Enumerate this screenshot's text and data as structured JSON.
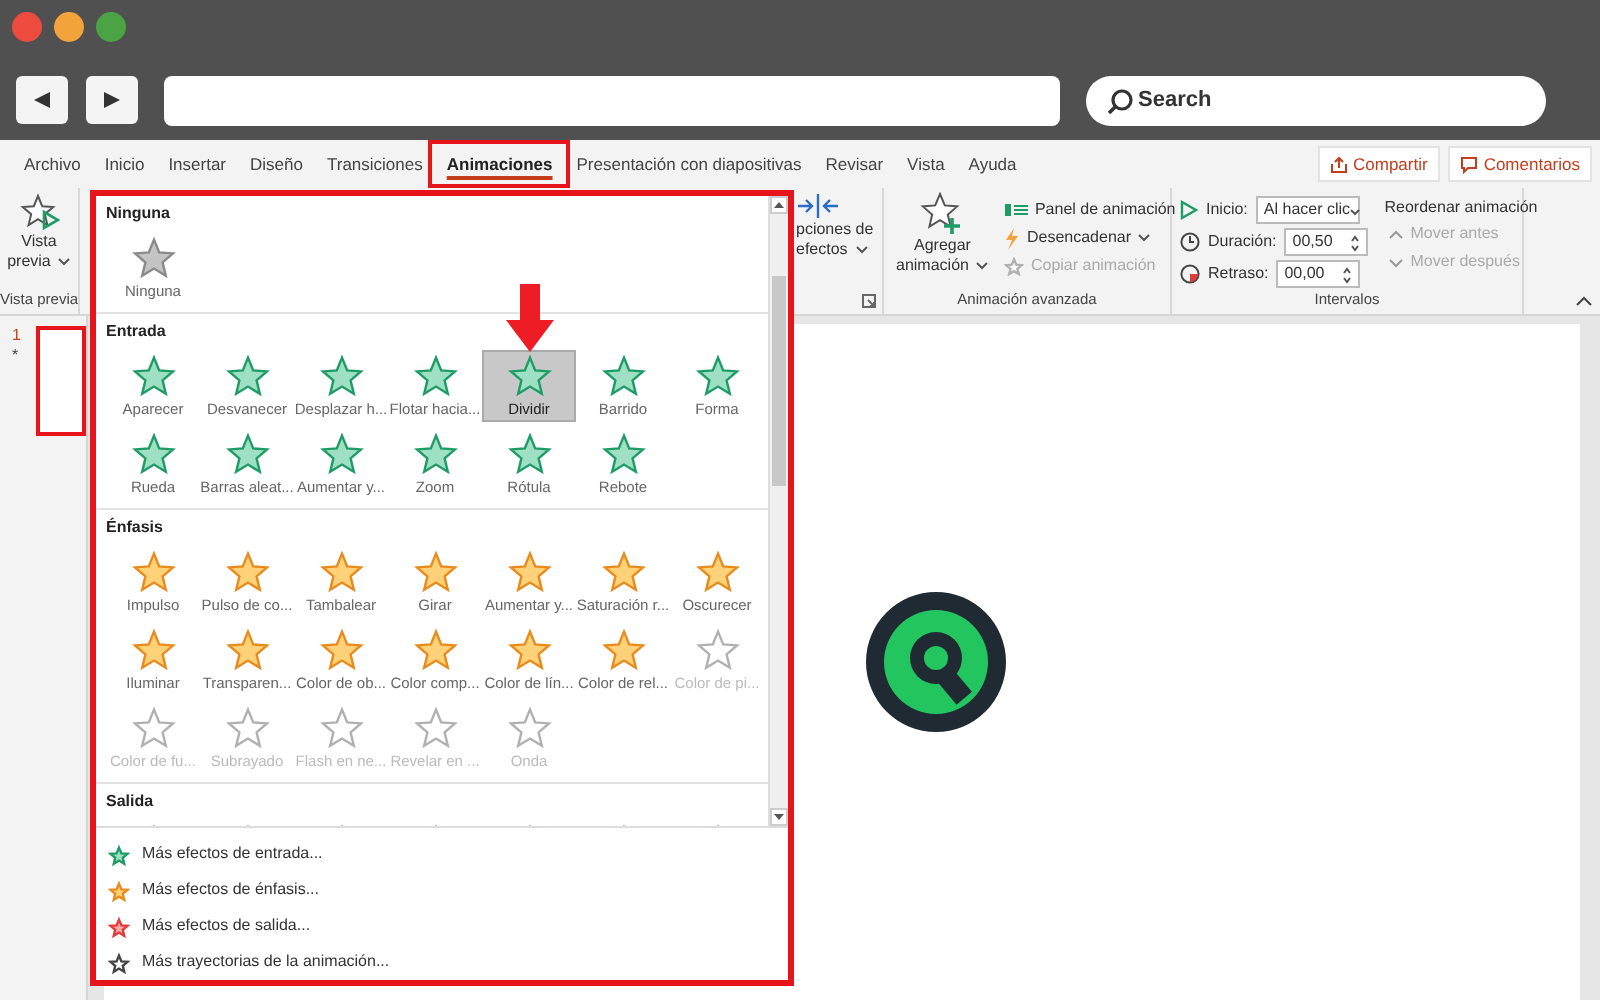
{
  "browser": {
    "search": {
      "placeholder": "Search"
    }
  },
  "ribbon": {
    "tabs": [
      {
        "label": "Archivo",
        "selected": false
      },
      {
        "label": "Inicio",
        "selected": false
      },
      {
        "label": "Insertar",
        "selected": false
      },
      {
        "label": "Diseño",
        "selected": false
      },
      {
        "label": "Transiciones",
        "selected": false
      },
      {
        "label": "Animaciones",
        "selected": true
      },
      {
        "label": "Presentación con diapositivas",
        "selected": false
      },
      {
        "label": "Revisar",
        "selected": false
      },
      {
        "label": "Vista",
        "selected": false
      },
      {
        "label": "Ayuda",
        "selected": false
      }
    ],
    "share_button": "Compartir",
    "comments_button": "Comentarios",
    "preview": {
      "label_line_1": "Vista",
      "label_line_2": "previa",
      "group": "Vista previa"
    },
    "effect_options": {
      "label_line_1": "pciones de",
      "label_line_2": "efectos"
    },
    "advanced": {
      "add_line_1": "Agregar",
      "add_line_2": "animación",
      "panel": "Panel de animación",
      "trigger": "Desencadenar",
      "copy": {
        "label": "Copiar animación",
        "disabled": true
      },
      "group": "Animación avanzada"
    },
    "timing": {
      "start_label": "Inicio:",
      "start_value": "Al hacer clic",
      "duration_label": "Duración:",
      "duration_value": "00,50",
      "delay_label": "Retraso:",
      "delay_value": "00,00",
      "reorder": "Reordenar animación",
      "move_earlier": {
        "label": "Mover antes",
        "disabled": true
      },
      "move_later": {
        "label": "Mover después",
        "disabled": true
      },
      "group": "Intervalos"
    }
  },
  "slides": [
    {
      "number": "1",
      "mark": "*",
      "selected": true
    }
  ],
  "gallery": {
    "sections": [
      {
        "title": "Ninguna",
        "kind": "none",
        "items": [
          {
            "label": "Ninguna",
            "selected": false,
            "disabled": false
          }
        ]
      },
      {
        "title": "Entrada",
        "kind": "entrance",
        "items": [
          {
            "label": "Aparecer",
            "selected": false,
            "disabled": false
          },
          {
            "label": "Desvanecer",
            "selected": false,
            "disabled": false
          },
          {
            "label": "Desplazar h...",
            "selected": false,
            "disabled": false
          },
          {
            "label": "Flotar hacia...",
            "selected": false,
            "disabled": false
          },
          {
            "label": "Dividir",
            "selected": true,
            "disabled": false
          },
          {
            "label": "Barrido",
            "selected": false,
            "disabled": false
          },
          {
            "label": "Forma",
            "selected": false,
            "disabled": false
          },
          {
            "label": "Rueda",
            "selected": false,
            "disabled": false
          },
          {
            "label": "Barras aleat...",
            "selected": false,
            "disabled": false
          },
          {
            "label": "Aumentar y...",
            "selected": false,
            "disabled": false
          },
          {
            "label": "Zoom",
            "selected": false,
            "disabled": false
          },
          {
            "label": "Rótula",
            "selected": false,
            "disabled": false
          },
          {
            "label": "Rebote",
            "selected": false,
            "disabled": false
          }
        ]
      },
      {
        "title": "Énfasis",
        "kind": "emphasis",
        "items": [
          {
            "label": "Impulso",
            "selected": false,
            "disabled": false
          },
          {
            "label": "Pulso de co...",
            "selected": false,
            "disabled": false
          },
          {
            "label": "Tambalear",
            "selected": false,
            "disabled": false
          },
          {
            "label": "Girar",
            "selected": false,
            "disabled": false
          },
          {
            "label": "Aumentar y...",
            "selected": false,
            "disabled": false
          },
          {
            "label": "Saturación r...",
            "selected": false,
            "disabled": false
          },
          {
            "label": "Oscurecer",
            "selected": false,
            "disabled": false
          },
          {
            "label": "Iluminar",
            "selected": false,
            "disabled": false
          },
          {
            "label": "Transparen...",
            "selected": false,
            "disabled": false
          },
          {
            "label": "Color de ob...",
            "selected": false,
            "disabled": false
          },
          {
            "label": "Color comp...",
            "selected": false,
            "disabled": false
          },
          {
            "label": "Color de lín...",
            "selected": false,
            "disabled": false
          },
          {
            "label": "Color de rel...",
            "selected": false,
            "disabled": false
          },
          {
            "label": "Color de pi...",
            "selected": false,
            "disabled": true
          },
          {
            "label": "Color de fu...",
            "selected": false,
            "disabled": true
          },
          {
            "label": "Subrayado",
            "selected": false,
            "disabled": true
          },
          {
            "label": "Flash en ne...",
            "selected": false,
            "disabled": true
          },
          {
            "label": "Revelar en ...",
            "selected": false,
            "disabled": true
          },
          {
            "label": "Onda",
            "selected": false,
            "disabled": true
          }
        ]
      },
      {
        "title": "Salida",
        "kind": "exit",
        "items": [
          {
            "selected": false
          },
          {
            "selected": false
          },
          {
            "selected": false
          },
          {
            "selected": false
          },
          {
            "selected": false
          },
          {
            "selected": false
          },
          {
            "selected": false
          }
        ]
      }
    ],
    "menu": [
      {
        "label": "Más efectos de entrada...",
        "kind": "entrance"
      },
      {
        "label": "Más efectos de énfasis...",
        "kind": "emphasis"
      },
      {
        "label": "Más efectos de salida...",
        "kind": "exit"
      },
      {
        "label": "Más trayectorias de la animación...",
        "kind": "path"
      }
    ]
  }
}
